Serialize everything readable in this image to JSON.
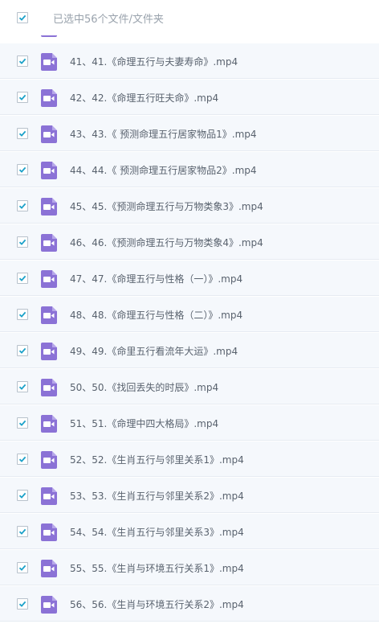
{
  "header": {
    "label": "已选中56个文件/文件夹"
  },
  "files": [
    "41、41.《命理五行与夫妻寿命》.mp4",
    "42、42.《命理五行旺夫命》.mp4",
    "43、43.《 预测命理五行居家物品1》.mp4",
    "44、44.《 预测命理五行居家物品2》.mp4",
    "45、45.《预测命理五行与万物类象3》.mp4",
    "46、46.《预测命理五行与万物类象4》.mp4",
    "47、47.《命理五行与性格（一）》.mp4",
    "48、48.《命理五行与性格（二）》.mp4",
    "49、49.《命里五行看流年大运》.mp4",
    "50、50.《找回丢失的时辰》.mp4",
    "51、51.《命理中四大格局》.mp4",
    "52、52.《生肖五行与邻里关系1》.mp4",
    "53、53.《生肖五行与邻里关系2》.mp4",
    "54、54.《生肖五行与邻里关系3》.mp4",
    "55、55.《生肖与环境五行关系1》.mp4",
    "56、56.《生肖与环境五行关系2》.mp4"
  ],
  "colors": {
    "check": "#1ba1c9",
    "file_icon": "#8b72d6",
    "row_bg": "#f5f8fc"
  },
  "icons": {
    "checkbox": "checkbox-checked-icon",
    "file": "video-file-icon"
  }
}
